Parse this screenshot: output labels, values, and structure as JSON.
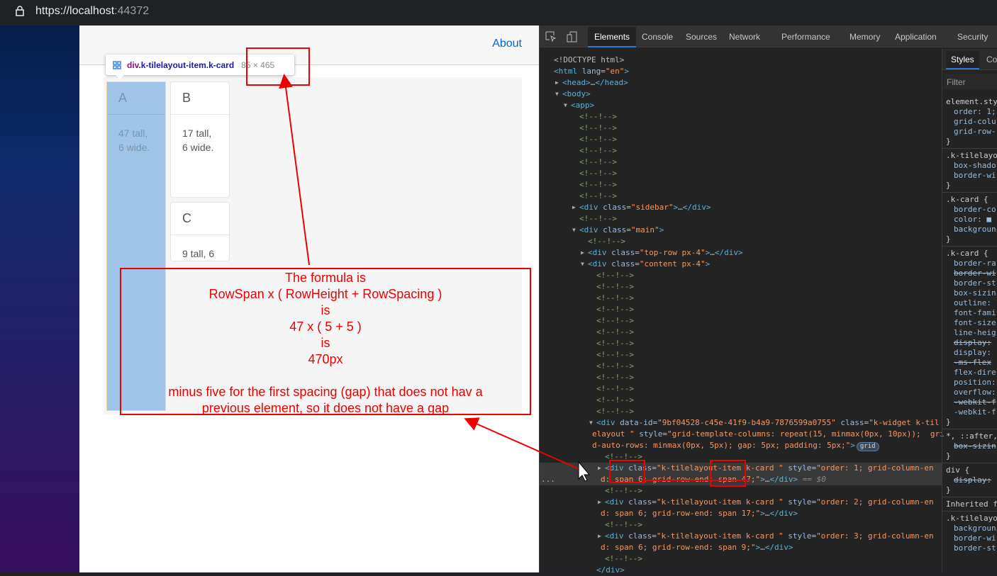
{
  "browser": {
    "url_host": "https://localhost",
    "url_port": ":44372"
  },
  "app": {
    "about_link": "About"
  },
  "tiles": [
    {
      "title": "A",
      "body_line1": "47 tall,",
      "body_line2": "6 wide."
    },
    {
      "title": "B",
      "body_line1": "17 tall,",
      "body_line2": "6 wide."
    },
    {
      "title": "C",
      "body_line1": "9 tall, 6",
      "body_line2": ""
    }
  ],
  "inspect_tooltip": {
    "tag": "div",
    "classes": ".k-tilelayout-item.k-card",
    "dimensions": "85 × 465"
  },
  "annotation": {
    "lines": [
      "The formula is",
      "RowSpan x ( RowHeight + RowSpacing )",
      "is",
      "47 x ( 5 + 5 )",
      "is",
      "470px",
      "",
      "minus five for the first spacing (gap) that does not hav a",
      "previous element, so it does not have a gap"
    ]
  },
  "devtools": {
    "tabs": [
      "Elements",
      "Console",
      "Sources",
      "Network",
      "Performance",
      "Memory",
      "Application",
      "Security"
    ],
    "active_tab": "Elements",
    "sidebar_tabs": [
      "Styles",
      "Co"
    ],
    "filter_placeholder": "Filter",
    "dom_lines": [
      [
        0,
        "",
        [
          [
            "p",
            "<!DOCTYPE html>"
          ]
        ]
      ],
      [
        0,
        "",
        [
          [
            "t",
            "<html "
          ],
          [
            "a",
            "lang"
          ],
          [
            "p",
            "="
          ],
          [
            "v",
            "\"en\""
          ],
          [
            "t",
            ">"
          ]
        ]
      ],
      [
        1,
        "r",
        [
          [
            "t",
            "<head>"
          ],
          [
            "p",
            "…"
          ],
          [
            "t",
            "</head>"
          ]
        ]
      ],
      [
        1,
        "d",
        [
          [
            "t",
            "<body>"
          ]
        ]
      ],
      [
        2,
        "d",
        [
          [
            "t",
            "<app>"
          ]
        ]
      ],
      [
        3,
        "",
        [
          [
            "c2",
            "<!--!-->"
          ]
        ]
      ],
      [
        3,
        "",
        [
          [
            "c2",
            "<!--!-->"
          ]
        ]
      ],
      [
        3,
        "",
        [
          [
            "c2",
            "<!--!-->"
          ]
        ]
      ],
      [
        3,
        "",
        [
          [
            "c2",
            "<!--!-->"
          ]
        ]
      ],
      [
        3,
        "",
        [
          [
            "c2",
            "<!--!-->"
          ]
        ]
      ],
      [
        3,
        "",
        [
          [
            "c2",
            "<!--!-->"
          ]
        ]
      ],
      [
        3,
        "",
        [
          [
            "c2",
            "<!--!-->"
          ]
        ]
      ],
      [
        3,
        "",
        [
          [
            "c2",
            "<!--!-->"
          ]
        ]
      ],
      [
        3,
        "r",
        [
          [
            "t",
            "<div "
          ],
          [
            "a",
            "class"
          ],
          [
            "p",
            "="
          ],
          [
            "v",
            "\"sidebar\""
          ],
          [
            "t",
            ">"
          ],
          [
            "p",
            "…"
          ],
          [
            "t",
            "</div>"
          ]
        ]
      ],
      [
        3,
        "",
        [
          [
            "c2",
            "<!--!-->"
          ]
        ]
      ],
      [
        3,
        "d",
        [
          [
            "t",
            "<div "
          ],
          [
            "a",
            "class"
          ],
          [
            "p",
            "="
          ],
          [
            "v",
            "\"main\""
          ],
          [
            "t",
            ">"
          ]
        ]
      ],
      [
        4,
        "",
        [
          [
            "c2",
            "<!--!-->"
          ]
        ]
      ],
      [
        4,
        "r",
        [
          [
            "t",
            "<div "
          ],
          [
            "a",
            "class"
          ],
          [
            "p",
            "="
          ],
          [
            "v",
            "\"top-row px-4\""
          ],
          [
            "t",
            ">"
          ],
          [
            "p",
            "…"
          ],
          [
            "t",
            "</div>"
          ]
        ]
      ],
      [
        4,
        "d",
        [
          [
            "t",
            "<div "
          ],
          [
            "a",
            "class"
          ],
          [
            "p",
            "="
          ],
          [
            "v",
            "\"content px-4\""
          ],
          [
            "t",
            ">"
          ]
        ]
      ],
      [
        5,
        "",
        [
          [
            "c2",
            "<!--!-->"
          ]
        ]
      ],
      [
        5,
        "",
        [
          [
            "c2",
            "<!--!-->"
          ]
        ]
      ],
      [
        5,
        "",
        [
          [
            "c2",
            "<!--!-->"
          ]
        ]
      ],
      [
        5,
        "",
        [
          [
            "c2",
            "<!--!-->"
          ]
        ]
      ],
      [
        5,
        "",
        [
          [
            "c2",
            "<!--!-->"
          ]
        ]
      ],
      [
        5,
        "",
        [
          [
            "c2",
            "<!--!-->"
          ]
        ]
      ],
      [
        5,
        "",
        [
          [
            "c2",
            "<!--!-->"
          ]
        ]
      ],
      [
        5,
        "",
        [
          [
            "c2",
            "<!--!-->"
          ]
        ]
      ],
      [
        5,
        "",
        [
          [
            "c2",
            "<!--!-->"
          ]
        ]
      ],
      [
        5,
        "",
        [
          [
            "c2",
            "<!--!-->"
          ]
        ]
      ],
      [
        5,
        "",
        [
          [
            "c2",
            "<!--!-->"
          ]
        ]
      ],
      [
        5,
        "",
        [
          [
            "c2",
            "<!--!-->"
          ]
        ]
      ],
      [
        5,
        "",
        [
          [
            "c2",
            "<!--!-->"
          ]
        ]
      ],
      [
        5,
        "d",
        [
          [
            "t",
            "<div "
          ],
          [
            "a",
            "data-id"
          ],
          [
            "p",
            "="
          ],
          [
            "v",
            "\"9bf04528-c45e-41f9-b4a9-7876599a0755\""
          ],
          [
            "a",
            " class"
          ],
          [
            "p",
            "="
          ],
          [
            "v",
            "\"k-widget k-til"
          ]
        ]
      ],
      [
        4.5,
        "",
        [
          [
            "v",
            "elayout \""
          ],
          [
            "a",
            " style"
          ],
          [
            "p",
            "="
          ],
          [
            "v",
            "\"grid-template-columns: repeat(15, minmax(0px, 10px));  gri"
          ]
        ]
      ],
      [
        4.5,
        "",
        [
          [
            "v",
            "d-auto-rows: minmax(0px, 5px); gap: 5px; padding: 5px;\""
          ],
          [
            "t",
            ">"
          ],
          [
            "badge",
            "grid"
          ]
        ]
      ],
      [
        6,
        "",
        [
          [
            "c2",
            "<!--!-->"
          ]
        ]
      ],
      [
        6,
        "rs",
        [
          [
            "t",
            "<div "
          ],
          [
            "a",
            "class"
          ],
          [
            "p",
            "="
          ],
          [
            "v",
            "\"k-tilelayout-item k-card \""
          ],
          [
            "a",
            " style"
          ],
          [
            "p",
            "="
          ],
          [
            "v",
            "\"order: 1; grid-column-en"
          ]
        ]
      ],
      [
        5.5,
        "s",
        [
          [
            "v",
            "d: span 6; grid-row-end: span 47;\""
          ],
          [
            "t",
            ">"
          ],
          [
            "p",
            "…"
          ],
          [
            "t",
            "</div>"
          ],
          [
            "gz",
            " == $0"
          ]
        ]
      ],
      [
        6,
        "",
        [
          [
            "c2",
            "<!--!-->"
          ]
        ]
      ],
      [
        6,
        "r",
        [
          [
            "t",
            "<div "
          ],
          [
            "a",
            "class"
          ],
          [
            "p",
            "="
          ],
          [
            "v",
            "\"k-tilelayout-item k-card \""
          ],
          [
            "a",
            " style"
          ],
          [
            "p",
            "="
          ],
          [
            "v",
            "\"order: 2; grid-column-en"
          ]
        ]
      ],
      [
        5.5,
        "",
        [
          [
            "v",
            "d: span 6; grid-row-end: span 17;\""
          ],
          [
            "t",
            ">"
          ],
          [
            "p",
            "…"
          ],
          [
            "t",
            "</div>"
          ]
        ]
      ],
      [
        6,
        "",
        [
          [
            "c2",
            "<!--!-->"
          ]
        ]
      ],
      [
        6,
        "r",
        [
          [
            "t",
            "<div "
          ],
          [
            "a",
            "class"
          ],
          [
            "p",
            "="
          ],
          [
            "v",
            "\"k-tilelayout-item k-card \""
          ],
          [
            "a",
            " style"
          ],
          [
            "p",
            "="
          ],
          [
            "v",
            "\"order: 3; grid-column-en"
          ]
        ]
      ],
      [
        5.5,
        "",
        [
          [
            "v",
            "d: span 6; grid-row-end: span 9;\""
          ],
          [
            "t",
            ">"
          ],
          [
            "p",
            "…"
          ],
          [
            "t",
            "</div>"
          ]
        ]
      ],
      [
        6,
        "",
        [
          [
            "c2",
            "<!--!-->"
          ]
        ]
      ],
      [
        5,
        "",
        [
          [
            "t",
            "</div>"
          ]
        ]
      ]
    ],
    "styles_lines": [
      [
        "s",
        "element.sty"
      ],
      [
        "p",
        "order: 1;"
      ],
      [
        "p",
        "grid-colu"
      ],
      [
        "p",
        "grid-row-"
      ],
      [
        "s",
        "}"
      ],
      [
        "div",
        ""
      ],
      [
        "s",
        ".k-tilelayo"
      ],
      [
        "p",
        "box-shado"
      ],
      [
        "p",
        "border-wi"
      ],
      [
        "s",
        "}"
      ],
      [
        "div",
        ""
      ],
      [
        "s",
        ".k-card {"
      ],
      [
        "p",
        "border-co"
      ],
      [
        "p",
        "color: ■"
      ],
      [
        "p",
        "backgroun"
      ],
      [
        "s",
        "}"
      ],
      [
        "div",
        ""
      ],
      [
        "s",
        ".k-card {"
      ],
      [
        "p",
        "border-ra"
      ],
      [
        "px",
        "border-wi"
      ],
      [
        "p",
        "border-st"
      ],
      [
        "p",
        "box-sizin"
      ],
      [
        "p",
        "outline:"
      ],
      [
        "p",
        "font-fami"
      ],
      [
        "p",
        "font-size"
      ],
      [
        "p",
        "line-heig"
      ],
      [
        "px",
        "display:"
      ],
      [
        "p",
        "display:"
      ],
      [
        "px",
        "-ms-flex"
      ],
      [
        "p",
        "flex-dire"
      ],
      [
        "p",
        "position:"
      ],
      [
        "p",
        "overflow:"
      ],
      [
        "px",
        "-webkit-f"
      ],
      [
        "p",
        "-webkit-f"
      ],
      [
        "s",
        "}"
      ],
      [
        "div",
        ""
      ],
      [
        "s",
        "*, ::after,"
      ],
      [
        "px",
        "box-sizin"
      ],
      [
        "s",
        "}"
      ],
      [
        "div",
        ""
      ],
      [
        "s",
        "div {"
      ],
      [
        "px",
        "display:"
      ],
      [
        "s",
        "}"
      ],
      [
        "div",
        ""
      ],
      [
        "s",
        "Inherited from"
      ],
      [
        "div",
        ""
      ],
      [
        "s",
        ".k-tilelayo"
      ],
      [
        "p",
        "backgroun"
      ],
      [
        "p",
        "border-wi"
      ],
      [
        "p",
        "border-st"
      ]
    ]
  }
}
